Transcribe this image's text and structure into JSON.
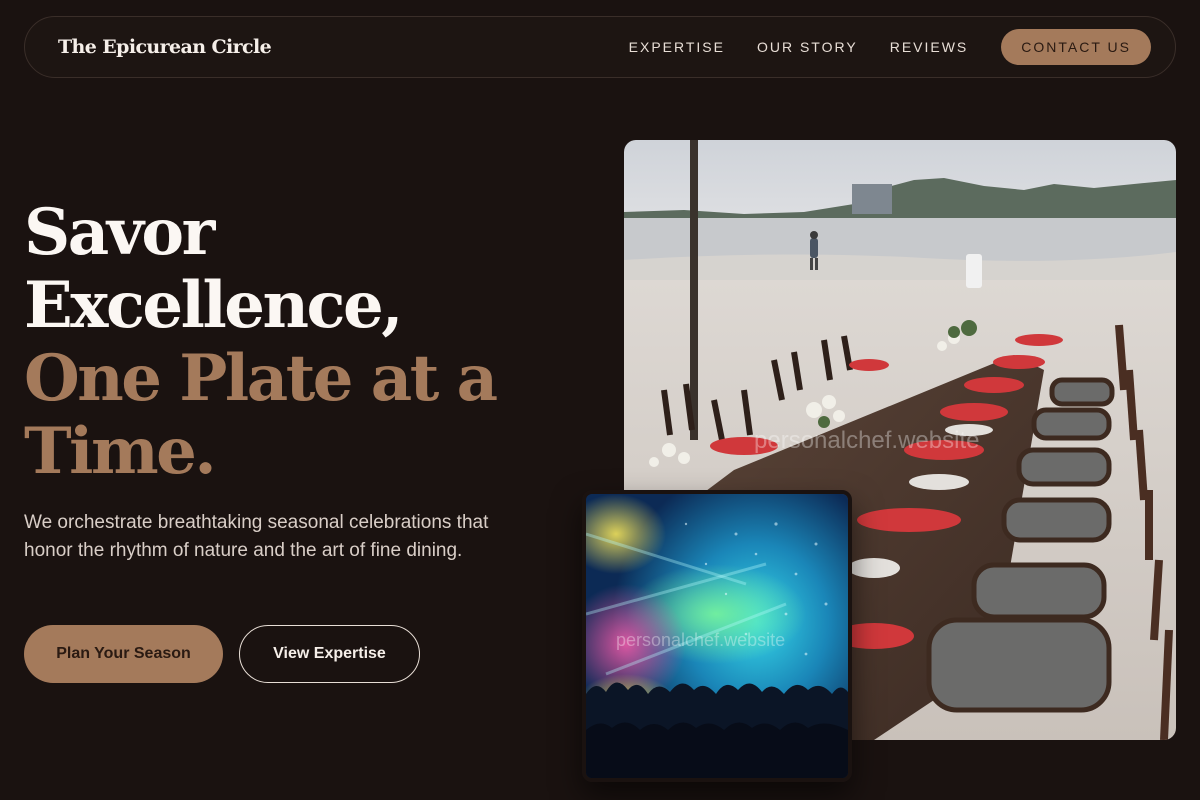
{
  "brand": {
    "name": "The Epicurean Circle"
  },
  "nav": {
    "links": [
      "EXPERTISE",
      "OUR STORY",
      "REVIEWS"
    ],
    "cta": "CONTACT US"
  },
  "hero": {
    "headline_lines": [
      "Savor",
      "Excellence,",
      "One Plate at a",
      "Time."
    ],
    "subcopy": "We orchestrate breathtaking seasonal celebrations that honor the rhythm of nature and the art of fine dining.",
    "primary_button": "Plan Your Season",
    "secondary_button": "View Expertise"
  },
  "images": {
    "main": {
      "watermark": "personalchef.website"
    },
    "inset": {
      "watermark": "personalchef.website"
    }
  },
  "colors": {
    "background": "#1a1210",
    "accent": "#a47a5b",
    "text": "#f3ece6"
  }
}
